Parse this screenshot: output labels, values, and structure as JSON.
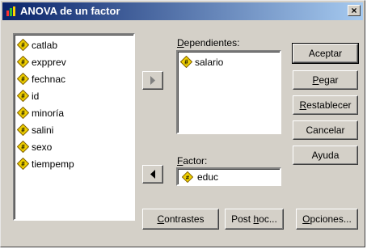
{
  "window": {
    "title": "ANOVA de un factor",
    "close_label": "×"
  },
  "source_list": {
    "items": [
      {
        "label": "catlab"
      },
      {
        "label": "expprev"
      },
      {
        "label": "fechnac"
      },
      {
        "label": "id"
      },
      {
        "label": "minoría"
      },
      {
        "label": "salini"
      },
      {
        "label": "sexo"
      },
      {
        "label": "tiempemp"
      }
    ]
  },
  "dependientes": {
    "label_prefix": "",
    "label_underlined": "D",
    "label_rest": "ependientes:",
    "items": [
      {
        "label": "salario"
      }
    ]
  },
  "factor": {
    "label_underlined": "F",
    "label_rest": "actor:",
    "value": "educ"
  },
  "buttons": {
    "aceptar": "Aceptar",
    "pegar_u": "P",
    "pegar_rest": "egar",
    "restablecer_u": "R",
    "restablecer_rest": "establecer",
    "cancelar": "Cancelar",
    "ayuda": "Ayuda",
    "contrastes_u": "C",
    "contrastes_rest": "ontrastes",
    "posthoc_pre": "Post ",
    "posthoc_u": "h",
    "posthoc_rest": "oc...",
    "opciones_u": "O",
    "opciones_rest": "pciones..."
  },
  "icons": {
    "variable": "scale-variable-icon",
    "move_right": "arrow-right-icon",
    "move_left": "arrow-left-icon"
  },
  "colors": {
    "dialog_bg": "#d4d0c8",
    "title_start": "#0a246a",
    "title_end": "#a6caf0",
    "var_icon_fill": "#f0d000"
  }
}
